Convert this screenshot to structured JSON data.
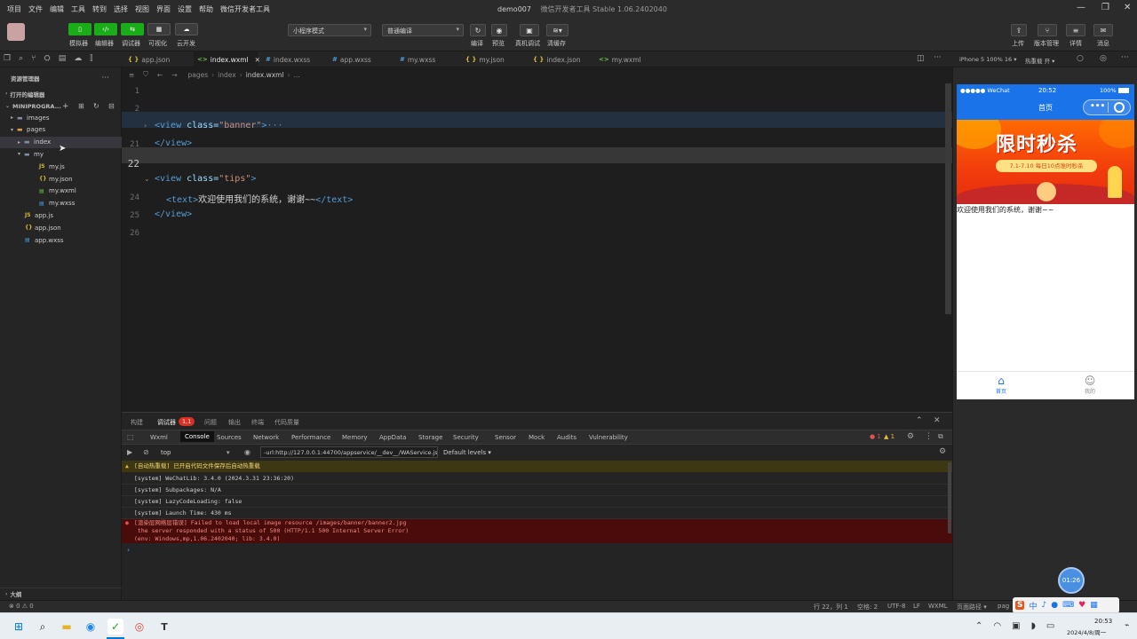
{
  "menu": {
    "items": [
      "项目",
      "文件",
      "编辑",
      "工具",
      "转到",
      "选择",
      "视图",
      "界面",
      "设置",
      "帮助",
      "微信开发者工具"
    ],
    "project_name": "demo007",
    "app_title": "微信开发者工具 Stable 1.06.2402040"
  },
  "toolbar": {
    "simulator_label": "模拟器",
    "editor_label": "编辑器",
    "debugger_label": "调试器",
    "visual_label": "可视化",
    "cloud_label": "云开发",
    "mode_select": "小程序模式",
    "compile_select": "普通编译",
    "compile_label": "编译",
    "preview_label": "预览",
    "realdevice_label": "真机调试",
    "clearcache_label": "清缓存",
    "upload_label": "上传",
    "version_label": "版本管理",
    "details_label": "详情",
    "messages_label": "消息"
  },
  "tabs": [
    {
      "icon": "{ }",
      "label": "app.json",
      "kind": "json"
    },
    {
      "icon": "<>",
      "label": "index.wxml",
      "kind": "wxml",
      "active": true,
      "close": "✕"
    },
    {
      "icon": "#",
      "label": "index.wxss",
      "kind": "wxss"
    },
    {
      "icon": "#",
      "label": "app.wxss",
      "kind": "wxss"
    },
    {
      "icon": "#",
      "label": "my.wxss",
      "kind": "wxss"
    },
    {
      "icon": "{ }",
      "label": "my.json",
      "kind": "json"
    },
    {
      "icon": "{ }",
      "label": "index.json",
      "kind": "json"
    },
    {
      "icon": "<>",
      "label": "my.wxml",
      "kind": "wxml"
    }
  ],
  "device": {
    "select": "iPhone 5 100% 16 ▾",
    "hotreload": "热重载 开 ▾"
  },
  "sidebar": {
    "header": "资源管理器",
    "more": "···",
    "open_editors": "打开的编辑器",
    "project": "MINIPROGRA...",
    "tree": [
      {
        "label": "images",
        "indent": 1,
        "type": "folder"
      },
      {
        "label": "pages",
        "indent": 1,
        "type": "folder-open",
        "orange": true
      },
      {
        "label": "index",
        "indent": 2,
        "type": "folder",
        "selected": true
      },
      {
        "label": "my",
        "indent": 2,
        "type": "folder-open"
      },
      {
        "label": "my.js",
        "indent": 3,
        "type": "js"
      },
      {
        "label": "my.json",
        "indent": 3,
        "type": "json"
      },
      {
        "label": "my.wxml",
        "indent": 3,
        "type": "wxml"
      },
      {
        "label": "my.wxss",
        "indent": 3,
        "type": "wxss"
      },
      {
        "label": "app.js",
        "indent": 1,
        "type": "js"
      },
      {
        "label": "app.json",
        "indent": 1,
        "type": "json"
      },
      {
        "label": "app.wxss",
        "indent": 1,
        "type": "wxss"
      }
    ],
    "outline": "大纲",
    "problems": "⊗ 0 ⚠ 0"
  },
  "editor": {
    "breadcrumb": [
      "pages",
      "index",
      "index.wxml",
      "..."
    ],
    "lines": [
      {
        "num": "1",
        "code": ""
      },
      {
        "num": "2",
        "code": ""
      },
      {
        "num": "",
        "tag_open": "<view ",
        "attr": "class=",
        "str": "\"banner\"",
        "close": ">",
        "fold": "···"
      },
      {
        "num": "21",
        "tag_open": "</view>"
      },
      {
        "num": "22",
        "code": ""
      },
      {
        "num": "",
        "tag_open": "<view ",
        "attr": "class=",
        "str": "\"tips\"",
        "close": ">"
      },
      {
        "num": "24",
        "indent": true,
        "tag_open": "<text>",
        "text": "欢迎使用我们的系统，谢谢~~",
        "tag_close": "</text>"
      },
      {
        "num": "25",
        "tag_open": "</view>"
      },
      {
        "num": "26",
        "code": ""
      }
    ]
  },
  "phone": {
    "carrier": "●●●●● WeChat",
    "time": "20:52",
    "battery": "100%",
    "title": "首页",
    "capsule_more": "•••",
    "banner_title": "限时秒杀",
    "banner_sub": "7.1-7.10 每日10点准时秒杀",
    "tips_text": "欢迎使用我们的系统，谢谢~~",
    "tab_home": "首页",
    "tab_mine": "我的"
  },
  "devtools": {
    "tabs": [
      "构建",
      "调试器",
      "问题",
      "输出",
      "终端",
      "代码质量"
    ],
    "badge": "1,1",
    "subtabs": [
      "Wxml",
      "Console",
      "Sources",
      "Network",
      "Performance",
      "Memory",
      "AppData",
      "Storage",
      "Security",
      "Sensor",
      "Mock",
      "Audits",
      "Vulnerability"
    ],
    "errors": "1",
    "warnings": "1",
    "context": "top",
    "filter": "-url:http://127.0.0.1:44700/appservice/__dev__/WAService.js",
    "levels": "Default levels ▾",
    "logs": [
      {
        "type": "warn",
        "text": "[自动热重载] 已开启代码文件保存后自动热重载"
      },
      {
        "type": "info",
        "text": "[system] WeChatLib: 3.4.0 (2024.3.31 23:36:20)"
      },
      {
        "type": "info",
        "text": "[system] Subpackages: N/A"
      },
      {
        "type": "info",
        "text": "[system] LazyCodeLoading: false"
      },
      {
        "type": "info",
        "text": "[system] Launch Time: 430 ms"
      },
      {
        "type": "error",
        "text": "[渲染层网络层错误] Failed to load local image resource /images/banner/banner2.jpg"
      },
      {
        "type": "error-cont",
        "text": " the server responded with a status of 500 (HTTP/1.1 500 Internal Server Error)"
      },
      {
        "type": "error-cont",
        "text": "(env: Windows,mp,1.06.2402040; lib: 3.4.0)"
      }
    ],
    "prompt": "›"
  },
  "statusbar": {
    "pos": "行 22，列 1",
    "spaces": "空格: 2",
    "encoding": "UTF-8",
    "eol": "LF",
    "lang": "WXML",
    "pagepath": "页面路径 ▾",
    "page": "pag"
  },
  "timer": "01:26",
  "taskbar": {
    "ime": "中",
    "time": "20:53",
    "date": "2024/4/8/周一"
  },
  "colors": {
    "accent_green": "#1aad19",
    "phone_blue": "#1a73e8",
    "error_bg": "#4a0b0b",
    "warn_bg": "#3d3713"
  }
}
